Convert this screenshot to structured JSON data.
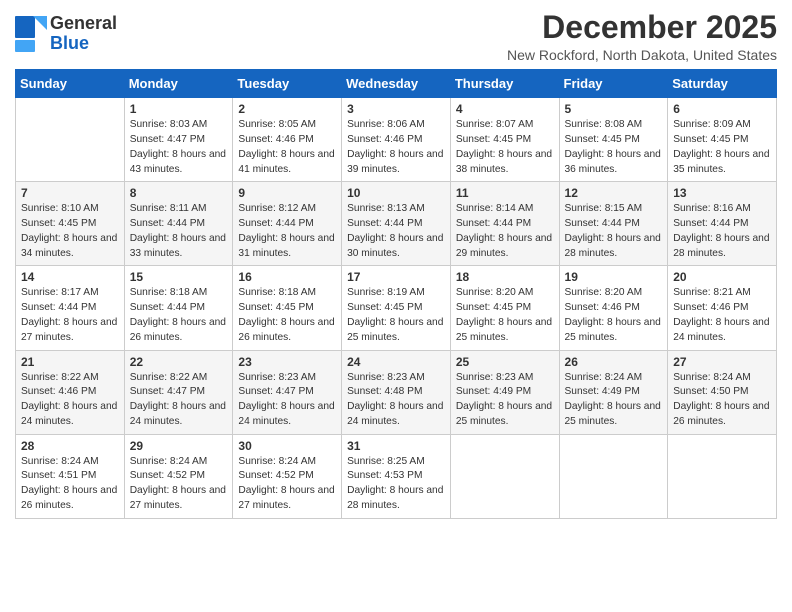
{
  "app": {
    "logo_general": "General",
    "logo_blue": "Blue",
    "month": "December 2025",
    "location": "New Rockford, North Dakota, United States"
  },
  "weekdays": [
    "Sunday",
    "Monday",
    "Tuesday",
    "Wednesday",
    "Thursday",
    "Friday",
    "Saturday"
  ],
  "weeks": [
    [
      {
        "day": "",
        "sunrise": "",
        "sunset": "",
        "daylight": ""
      },
      {
        "day": "1",
        "sunrise": "Sunrise: 8:03 AM",
        "sunset": "Sunset: 4:47 PM",
        "daylight": "Daylight: 8 hours and 43 minutes."
      },
      {
        "day": "2",
        "sunrise": "Sunrise: 8:05 AM",
        "sunset": "Sunset: 4:46 PM",
        "daylight": "Daylight: 8 hours and 41 minutes."
      },
      {
        "day": "3",
        "sunrise": "Sunrise: 8:06 AM",
        "sunset": "Sunset: 4:46 PM",
        "daylight": "Daylight: 8 hours and 39 minutes."
      },
      {
        "day": "4",
        "sunrise": "Sunrise: 8:07 AM",
        "sunset": "Sunset: 4:45 PM",
        "daylight": "Daylight: 8 hours and 38 minutes."
      },
      {
        "day": "5",
        "sunrise": "Sunrise: 8:08 AM",
        "sunset": "Sunset: 4:45 PM",
        "daylight": "Daylight: 8 hours and 36 minutes."
      },
      {
        "day": "6",
        "sunrise": "Sunrise: 8:09 AM",
        "sunset": "Sunset: 4:45 PM",
        "daylight": "Daylight: 8 hours and 35 minutes."
      }
    ],
    [
      {
        "day": "7",
        "sunrise": "Sunrise: 8:10 AM",
        "sunset": "Sunset: 4:45 PM",
        "daylight": "Daylight: 8 hours and 34 minutes."
      },
      {
        "day": "8",
        "sunrise": "Sunrise: 8:11 AM",
        "sunset": "Sunset: 4:44 PM",
        "daylight": "Daylight: 8 hours and 33 minutes."
      },
      {
        "day": "9",
        "sunrise": "Sunrise: 8:12 AM",
        "sunset": "Sunset: 4:44 PM",
        "daylight": "Daylight: 8 hours and 31 minutes."
      },
      {
        "day": "10",
        "sunrise": "Sunrise: 8:13 AM",
        "sunset": "Sunset: 4:44 PM",
        "daylight": "Daylight: 8 hours and 30 minutes."
      },
      {
        "day": "11",
        "sunrise": "Sunrise: 8:14 AM",
        "sunset": "Sunset: 4:44 PM",
        "daylight": "Daylight: 8 hours and 29 minutes."
      },
      {
        "day": "12",
        "sunrise": "Sunrise: 8:15 AM",
        "sunset": "Sunset: 4:44 PM",
        "daylight": "Daylight: 8 hours and 28 minutes."
      },
      {
        "day": "13",
        "sunrise": "Sunrise: 8:16 AM",
        "sunset": "Sunset: 4:44 PM",
        "daylight": "Daylight: 8 hours and 28 minutes."
      }
    ],
    [
      {
        "day": "14",
        "sunrise": "Sunrise: 8:17 AM",
        "sunset": "Sunset: 4:44 PM",
        "daylight": "Daylight: 8 hours and 27 minutes."
      },
      {
        "day": "15",
        "sunrise": "Sunrise: 8:18 AM",
        "sunset": "Sunset: 4:44 PM",
        "daylight": "Daylight: 8 hours and 26 minutes."
      },
      {
        "day": "16",
        "sunrise": "Sunrise: 8:18 AM",
        "sunset": "Sunset: 4:45 PM",
        "daylight": "Daylight: 8 hours and 26 minutes."
      },
      {
        "day": "17",
        "sunrise": "Sunrise: 8:19 AM",
        "sunset": "Sunset: 4:45 PM",
        "daylight": "Daylight: 8 hours and 25 minutes."
      },
      {
        "day": "18",
        "sunrise": "Sunrise: 8:20 AM",
        "sunset": "Sunset: 4:45 PM",
        "daylight": "Daylight: 8 hours and 25 minutes."
      },
      {
        "day": "19",
        "sunrise": "Sunrise: 8:20 AM",
        "sunset": "Sunset: 4:46 PM",
        "daylight": "Daylight: 8 hours and 25 minutes."
      },
      {
        "day": "20",
        "sunrise": "Sunrise: 8:21 AM",
        "sunset": "Sunset: 4:46 PM",
        "daylight": "Daylight: 8 hours and 24 minutes."
      }
    ],
    [
      {
        "day": "21",
        "sunrise": "Sunrise: 8:22 AM",
        "sunset": "Sunset: 4:46 PM",
        "daylight": "Daylight: 8 hours and 24 minutes."
      },
      {
        "day": "22",
        "sunrise": "Sunrise: 8:22 AM",
        "sunset": "Sunset: 4:47 PM",
        "daylight": "Daylight: 8 hours and 24 minutes."
      },
      {
        "day": "23",
        "sunrise": "Sunrise: 8:23 AM",
        "sunset": "Sunset: 4:47 PM",
        "daylight": "Daylight: 8 hours and 24 minutes."
      },
      {
        "day": "24",
        "sunrise": "Sunrise: 8:23 AM",
        "sunset": "Sunset: 4:48 PM",
        "daylight": "Daylight: 8 hours and 24 minutes."
      },
      {
        "day": "25",
        "sunrise": "Sunrise: 8:23 AM",
        "sunset": "Sunset: 4:49 PM",
        "daylight": "Daylight: 8 hours and 25 minutes."
      },
      {
        "day": "26",
        "sunrise": "Sunrise: 8:24 AM",
        "sunset": "Sunset: 4:49 PM",
        "daylight": "Daylight: 8 hours and 25 minutes."
      },
      {
        "day": "27",
        "sunrise": "Sunrise: 8:24 AM",
        "sunset": "Sunset: 4:50 PM",
        "daylight": "Daylight: 8 hours and 26 minutes."
      }
    ],
    [
      {
        "day": "28",
        "sunrise": "Sunrise: 8:24 AM",
        "sunset": "Sunset: 4:51 PM",
        "daylight": "Daylight: 8 hours and 26 minutes."
      },
      {
        "day": "29",
        "sunrise": "Sunrise: 8:24 AM",
        "sunset": "Sunset: 4:52 PM",
        "daylight": "Daylight: 8 hours and 27 minutes."
      },
      {
        "day": "30",
        "sunrise": "Sunrise: 8:24 AM",
        "sunset": "Sunset: 4:52 PM",
        "daylight": "Daylight: 8 hours and 27 minutes."
      },
      {
        "day": "31",
        "sunrise": "Sunrise: 8:25 AM",
        "sunset": "Sunset: 4:53 PM",
        "daylight": "Daylight: 8 hours and 28 minutes."
      },
      {
        "day": "",
        "sunrise": "",
        "sunset": "",
        "daylight": ""
      },
      {
        "day": "",
        "sunrise": "",
        "sunset": "",
        "daylight": ""
      },
      {
        "day": "",
        "sunrise": "",
        "sunset": "",
        "daylight": ""
      }
    ]
  ]
}
